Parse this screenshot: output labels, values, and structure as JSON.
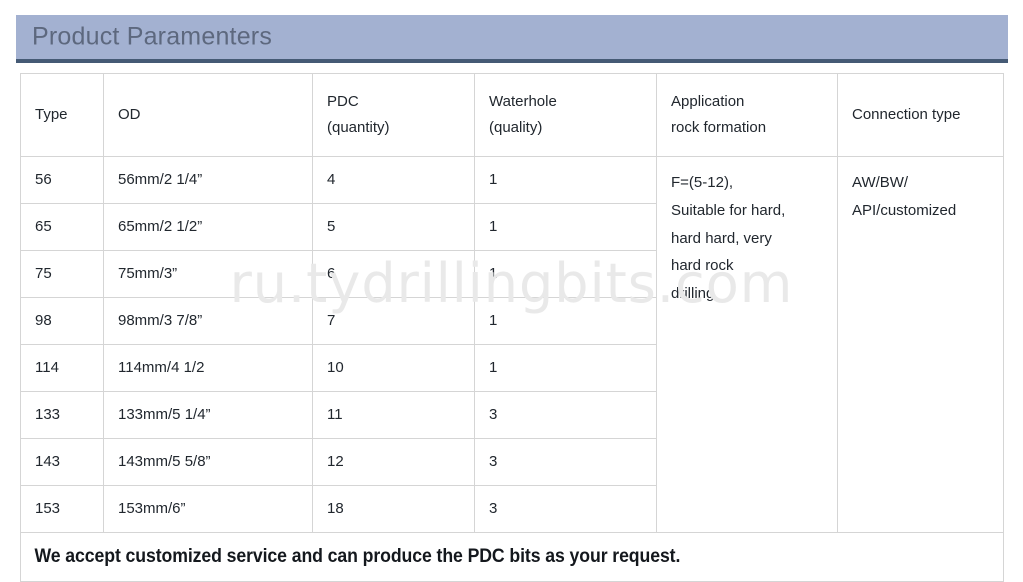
{
  "header": {
    "title": "Product Paramenters",
    "band_color": "#a3b1d1",
    "band_border_color": "#455a75",
    "title_color": "#5d687e"
  },
  "watermark": {
    "text": "ru.tydrillingbits.com",
    "color": "#e9e9e9"
  },
  "table": {
    "columns": [
      {
        "key": "type",
        "label_line1": "Type",
        "label_line2": ""
      },
      {
        "key": "od",
        "label_line1": "OD",
        "label_line2": ""
      },
      {
        "key": "pdc",
        "label_line1": "PDC",
        "label_line2": "(quantity)"
      },
      {
        "key": "waterhole",
        "label_line1": "Waterhole",
        "label_line2": "(quality)"
      },
      {
        "key": "application",
        "label_line1": "Application",
        "label_line2": "rock formation"
      },
      {
        "key": "connection",
        "label_line1": "Connection type",
        "label_line2": ""
      }
    ],
    "rows": [
      {
        "type": "56",
        "od": "56mm/2 1/4”",
        "pdc": "4",
        "waterhole": "1"
      },
      {
        "type": "65",
        "od": "65mm/2 1/2”",
        "pdc": "5",
        "waterhole": "1"
      },
      {
        "type": "75",
        "od": "75mm/3”",
        "pdc": "6",
        "waterhole": "1"
      },
      {
        "type": "98",
        "od": "98mm/3 7/8”",
        "pdc": "7",
        "waterhole": "1"
      },
      {
        "type": "114",
        "od": "114mm/4 1/2",
        "pdc": "10",
        "waterhole": "1"
      },
      {
        "type": "133",
        "od": "133mm/5 1/4”",
        "pdc": "11",
        "waterhole": "3"
      },
      {
        "type": "143",
        "od": "143mm/5 5/8”",
        "pdc": "12",
        "waterhole": "3"
      },
      {
        "type": "153",
        "od": "153mm/6”",
        "pdc": "18",
        "waterhole": "3"
      }
    ],
    "merged": {
      "application": {
        "lines": [
          "F=(5-12),",
          "Suitable for hard,",
          "hard hard, very",
          "hard rock",
          "drilling"
        ]
      },
      "connection": {
        "lines": [
          "AW/BW/",
          "API/customized"
        ]
      }
    },
    "footer_note": "We accept customized service and can produce the PDC bits as your request."
  }
}
